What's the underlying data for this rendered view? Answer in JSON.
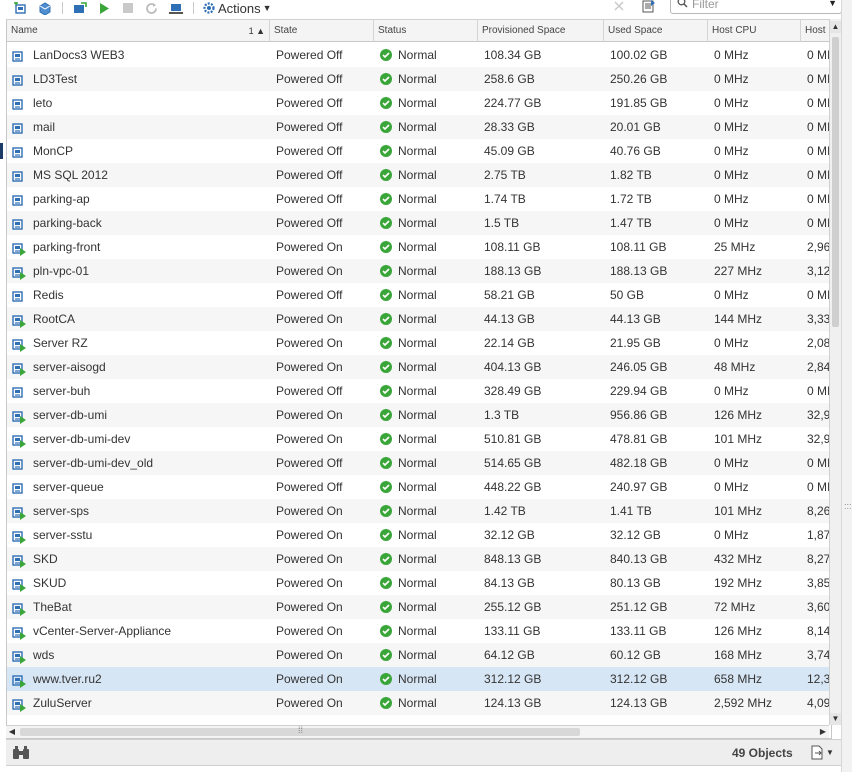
{
  "toolbar": {
    "actions_label": "Actions",
    "filter_placeholder": "Filter"
  },
  "columns": [
    {
      "label": "Name",
      "sort": "1 ▲"
    },
    {
      "label": "State"
    },
    {
      "label": "Status"
    },
    {
      "label": "Provisioned Space"
    },
    {
      "label": "Used Space"
    },
    {
      "label": "Host CPU"
    },
    {
      "label": "Host"
    }
  ],
  "rows": [
    {
      "name": "LanDocs3 WEB3",
      "state": "Powered Off",
      "status": "Normal",
      "prov": "108.34  GB",
      "used": "100.02  GB",
      "cpu": "0 MHz",
      "host": "0 MI"
    },
    {
      "name": "LD3Test",
      "state": "Powered Off",
      "status": "Normal",
      "prov": "258.6  GB",
      "used": "250.26  GB",
      "cpu": "0 MHz",
      "host": "0 MI"
    },
    {
      "name": "leto",
      "state": "Powered Off",
      "status": "Normal",
      "prov": "224.77  GB",
      "used": "191.85  GB",
      "cpu": "0 MHz",
      "host": "0 MI"
    },
    {
      "name": "mail",
      "state": "Powered Off",
      "status": "Normal",
      "prov": "28.33  GB",
      "used": "20.01  GB",
      "cpu": "0 MHz",
      "host": "0 MI"
    },
    {
      "name": "MonCP",
      "state": "Powered Off",
      "status": "Normal",
      "prov": "45.09  GB",
      "used": "40.76  GB",
      "cpu": "0 MHz",
      "host": "0 MI"
    },
    {
      "name": "MS SQL 2012",
      "state": "Powered Off",
      "status": "Normal",
      "prov": "2.75  TB",
      "used": "1.82  TB",
      "cpu": "0 MHz",
      "host": "0 MI"
    },
    {
      "name": "parking-ap",
      "state": "Powered Off",
      "status": "Normal",
      "prov": "1.74  TB",
      "used": "1.72  TB",
      "cpu": "0 MHz",
      "host": "0 MI"
    },
    {
      "name": "parking-back",
      "state": "Powered Off",
      "status": "Normal",
      "prov": "1.5  TB",
      "used": "1.47  TB",
      "cpu": "0 MHz",
      "host": "0 MI"
    },
    {
      "name": "parking-front",
      "state": "Powered On",
      "status": "Normal",
      "prov": "108.11  GB",
      "used": "108.11  GB",
      "cpu": "25 MHz",
      "host": "2,96"
    },
    {
      "name": "pln-vpc-01",
      "state": "Powered On",
      "status": "Normal",
      "prov": "188.13  GB",
      "used": "188.13  GB",
      "cpu": "227 MHz",
      "host": "3,12"
    },
    {
      "name": "Redis",
      "state": "Powered Off",
      "status": "Normal",
      "prov": "58.21  GB",
      "used": "50  GB",
      "cpu": "0 MHz",
      "host": "0 MI"
    },
    {
      "name": "RootCA",
      "state": "Powered On",
      "status": "Normal",
      "prov": "44.13  GB",
      "used": "44.13  GB",
      "cpu": "144 MHz",
      "host": "3,33"
    },
    {
      "name": "Server RZ",
      "state": "Powered On",
      "status": "Normal",
      "prov": "22.14  GB",
      "used": "21.95  GB",
      "cpu": "0 MHz",
      "host": "2,08"
    },
    {
      "name": "server-aisogd",
      "state": "Powered On",
      "status": "Normal",
      "prov": "404.13  GB",
      "used": "246.05  GB",
      "cpu": "48 MHz",
      "host": "2,84"
    },
    {
      "name": "server-buh",
      "state": "Powered Off",
      "status": "Normal",
      "prov": "328.49  GB",
      "used": "229.94  GB",
      "cpu": "0 MHz",
      "host": "0 MI"
    },
    {
      "name": "server-db-umi",
      "state": "Powered On",
      "status": "Normal",
      "prov": "1.3  TB",
      "used": "956.86  GB",
      "cpu": "126 MHz",
      "host": "32,9"
    },
    {
      "name": "server-db-umi-dev",
      "state": "Powered On",
      "status": "Normal",
      "prov": "510.81  GB",
      "used": "478.81  GB",
      "cpu": "101 MHz",
      "host": "32,9"
    },
    {
      "name": "server-db-umi-dev_old",
      "state": "Powered Off",
      "status": "Normal",
      "prov": "514.65  GB",
      "used": "482.18  GB",
      "cpu": "0 MHz",
      "host": "0 MI"
    },
    {
      "name": "server-queue",
      "state": "Powered Off",
      "status": "Normal",
      "prov": "448.22  GB",
      "used": "240.97  GB",
      "cpu": "0 MHz",
      "host": "0 MI"
    },
    {
      "name": "server-sps",
      "state": "Powered On",
      "status": "Normal",
      "prov": "1.42  TB",
      "used": "1.41  TB",
      "cpu": "101 MHz",
      "host": "8,26"
    },
    {
      "name": "server-sstu",
      "state": "Powered On",
      "status": "Normal",
      "prov": "32.12  GB",
      "used": "32.12  GB",
      "cpu": "0 MHz",
      "host": "1,87"
    },
    {
      "name": "SKD",
      "state": "Powered On",
      "status": "Normal",
      "prov": "848.13  GB",
      "used": "840.13  GB",
      "cpu": "432 MHz",
      "host": "8,27"
    },
    {
      "name": "SKUD",
      "state": "Powered On",
      "status": "Normal",
      "prov": "84.13  GB",
      "used": "80.13  GB",
      "cpu": "192 MHz",
      "host": "3,85"
    },
    {
      "name": "TheBat",
      "state": "Powered On",
      "status": "Normal",
      "prov": "255.12  GB",
      "used": "251.12  GB",
      "cpu": "72 MHz",
      "host": "3,60"
    },
    {
      "name": "vCenter-Server-Appliance",
      "state": "Powered On",
      "status": "Normal",
      "prov": "133.11  GB",
      "used": "133.11  GB",
      "cpu": "126 MHz",
      "host": "8,14"
    },
    {
      "name": "wds",
      "state": "Powered On",
      "status": "Normal",
      "prov": "64.12  GB",
      "used": "60.12  GB",
      "cpu": "168 MHz",
      "host": "3,74"
    },
    {
      "name": "www.tver.ru2",
      "state": "Powered On",
      "status": "Normal",
      "prov": "312.12  GB",
      "used": "312.12  GB",
      "cpu": "658 MHz",
      "host": "12,3",
      "selected": true
    },
    {
      "name": "ZuluServer",
      "state": "Powered On",
      "status": "Normal",
      "prov": "124.13  GB",
      "used": "124.13  GB",
      "cpu": "2,592 MHz",
      "host": "4,09"
    }
  ],
  "footer": {
    "object_count": "49 Objects"
  },
  "colors": {
    "selected_row": "#d7e6f5",
    "status_ok": "#3aa63a",
    "vm_icon": "#2f6fb5",
    "power_on": "#3aa63a"
  }
}
